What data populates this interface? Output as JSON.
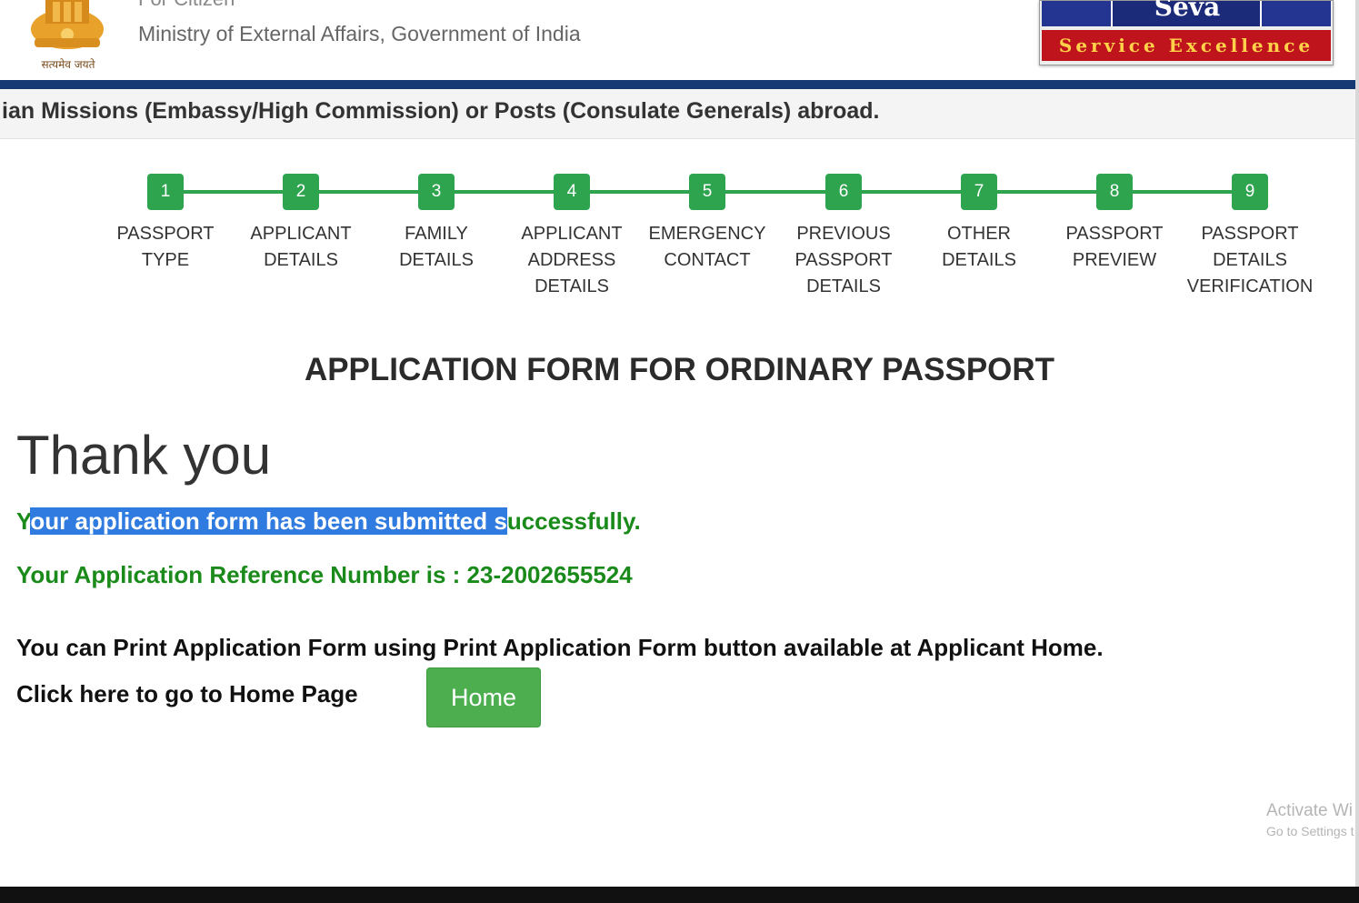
{
  "header": {
    "cut_title": "For Citizen",
    "ministry": "Ministry of External Affairs, Government of India",
    "emblem_caption": "सत्यमेव जयते",
    "logo_top_word": "Seva",
    "logo_tagline": "Service Excellence"
  },
  "marquee": {
    "text": "ian Missions (Embassy/High Commission) or Posts (Consulate Generals) abroad."
  },
  "steps": [
    {
      "num": "1",
      "label_lines": [
        "PASSPORT",
        "TYPE"
      ]
    },
    {
      "num": "2",
      "label_lines": [
        "APPLICANT",
        "DETAILS"
      ]
    },
    {
      "num": "3",
      "label_lines": [
        "FAMILY",
        "DETAILS"
      ]
    },
    {
      "num": "4",
      "label_lines": [
        "APPLICANT",
        "ADDRESS",
        "DETAILS"
      ]
    },
    {
      "num": "5",
      "label_lines": [
        "EMERGENCY",
        "CONTACT"
      ]
    },
    {
      "num": "6",
      "label_lines": [
        "PREVIOUS",
        "PASSPORT",
        "DETAILS"
      ]
    },
    {
      "num": "7",
      "label_lines": [
        "OTHER",
        "DETAILS"
      ]
    },
    {
      "num": "8",
      "label_lines": [
        "PASSPORT",
        "PREVIEW"
      ]
    },
    {
      "num": "9",
      "label_lines": [
        "PASSPORT",
        "DETAILS",
        "VERIFICATION"
      ]
    }
  ],
  "main": {
    "form_title": "APPLICATION FORM FOR ORDINARY PASSPORT",
    "thank_you": "Thank you",
    "success_prefix": "Y",
    "success_selected": "our application form has been submitted s",
    "success_suffix": "uccessfully.",
    "reference_line": "Your Application Reference Number is : 23-2002655524",
    "print_note": "You can Print Application Form using Print Application Form button available at Applicant Home.",
    "home_prompt": "Click here to go to Home Page",
    "home_button": "Home"
  },
  "watermark": {
    "line1": "Activate Wi",
    "line2": "Go to Settings t"
  },
  "colors": {
    "step_green": "#2ea44f",
    "button_green": "#4cae4f",
    "success_text": "#1a8a1a",
    "header_blue": "#163a73",
    "selection": "#2f7be0"
  }
}
